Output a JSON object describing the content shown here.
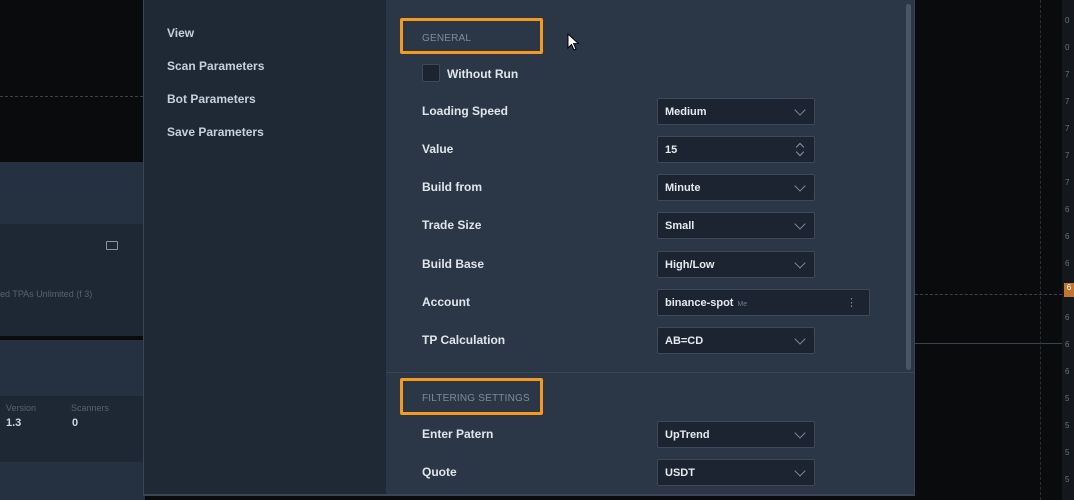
{
  "background": {
    "account_line": "ed TPAs Unlimited (f 3)",
    "version_label": "Version",
    "scanners_label": "Scanners",
    "version_value": "1.3",
    "scanners_value": "0",
    "right_ticks": [
      "0",
      "0",
      "7",
      "7",
      "7",
      "7",
      "7",
      "6",
      "6",
      "6",
      "6",
      "6",
      "6",
      "6",
      "5",
      "5",
      "5",
      "5"
    ],
    "right_tag": "6"
  },
  "dialog": {
    "nav": [
      "View",
      "Scan Parameters",
      "Bot Parameters",
      "Save Parameters"
    ],
    "sections": {
      "general": "GENERAL",
      "filtering": "FILTERING SETTINGS"
    },
    "without_run": {
      "label": "Without Run",
      "checked": false
    },
    "fields": [
      {
        "label": "Loading Speed",
        "value": "Medium",
        "kind": "select"
      },
      {
        "label": "Value",
        "value": "15",
        "kind": "number"
      },
      {
        "label": "Build from",
        "value": "Minute",
        "kind": "select"
      },
      {
        "label": "Trade Size",
        "value": "Small",
        "kind": "select"
      },
      {
        "label": "Build Base",
        "value": "High/Low",
        "kind": "select"
      },
      {
        "label": "Account",
        "value": "binance-spot",
        "sub": "Me",
        "kind": "account"
      },
      {
        "label": "TP Calculation",
        "value": "AB=CD",
        "kind": "select"
      }
    ],
    "filter_fields": [
      {
        "label": "Enter Patern",
        "value": "UpTrend",
        "kind": "select"
      },
      {
        "label": "Quote",
        "value": "USDT",
        "kind": "select"
      }
    ]
  },
  "colors": {
    "highlight": "#f59a1e",
    "panel": "#2b3646",
    "nav": "#1f2935"
  },
  "icons": [
    "folder-icon",
    "chevron-down-icon",
    "spinner-icon",
    "kebab-menu-icon",
    "mouse-cursor-icon"
  ]
}
